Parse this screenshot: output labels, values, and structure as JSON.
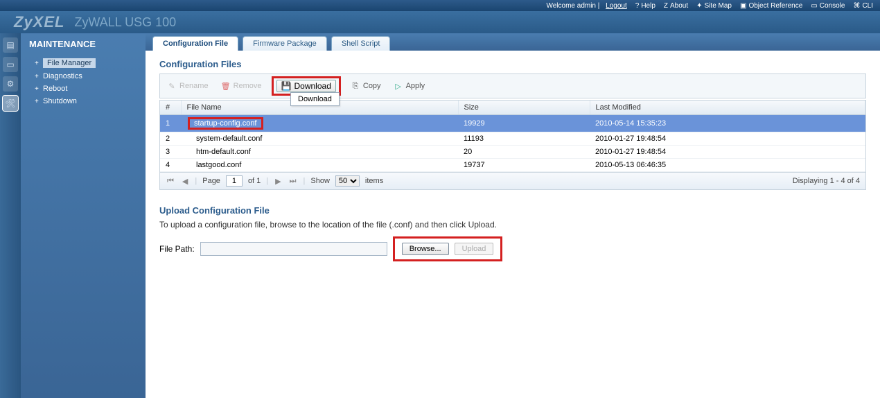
{
  "header": {
    "welcome": "Welcome admin |",
    "logout": "Logout",
    "help": "Help",
    "about": "About",
    "site_map": "Site Map",
    "object_ref": "Object Reference",
    "console": "Console",
    "cli": "CLI"
  },
  "logo": {
    "brand": "ZyXEL",
    "product": "ZyWALL USG 100"
  },
  "sidebar": {
    "title": "MAINTENANCE",
    "items": [
      {
        "label": "File Manager",
        "selected": true
      },
      {
        "label": "Diagnostics",
        "selected": false
      },
      {
        "label": "Reboot",
        "selected": false
      },
      {
        "label": "Shutdown",
        "selected": false
      }
    ]
  },
  "tabs": [
    {
      "label": "Configuration File",
      "active": true
    },
    {
      "label": "Firmware Package",
      "active": false
    },
    {
      "label": "Shell Script",
      "active": false
    }
  ],
  "config_section": {
    "title": "Configuration Files",
    "toolbar": {
      "rename": "Rename",
      "remove": "Remove",
      "download": "Download",
      "copy": "Copy",
      "apply": "Apply"
    },
    "tooltip": "Download",
    "columns": {
      "num": "#",
      "name": "File Name",
      "size": "Size",
      "modified": "Last Modified"
    },
    "rows": [
      {
        "n": "1",
        "name": "startup-config.conf",
        "size": "19929",
        "modified": "2010-05-14 15:35:23",
        "selected": true,
        "highlight": true
      },
      {
        "n": "2",
        "name": "system-default.conf",
        "size": "11193",
        "modified": "2010-01-27 19:48:54",
        "selected": false,
        "highlight": false
      },
      {
        "n": "3",
        "name": "htm-default.conf",
        "size": "20",
        "modified": "2010-01-27 19:48:54",
        "selected": false,
        "highlight": false
      },
      {
        "n": "4",
        "name": "lastgood.conf",
        "size": "19737",
        "modified": "2010-05-13 06:46:35",
        "selected": false,
        "highlight": false
      }
    ],
    "pager": {
      "page_label": "Page",
      "page_value": "1",
      "of_label": "of 1",
      "show_label": "Show",
      "show_value": "50",
      "items_label": "items",
      "display_text": "Displaying 1 - 4 of 4"
    }
  },
  "upload_section": {
    "title": "Upload Configuration File",
    "description": "To upload a configuration file, browse to the location of the file (.conf) and then click Upload.",
    "path_label": "File Path:",
    "browse": "Browse...",
    "upload": "Upload"
  }
}
